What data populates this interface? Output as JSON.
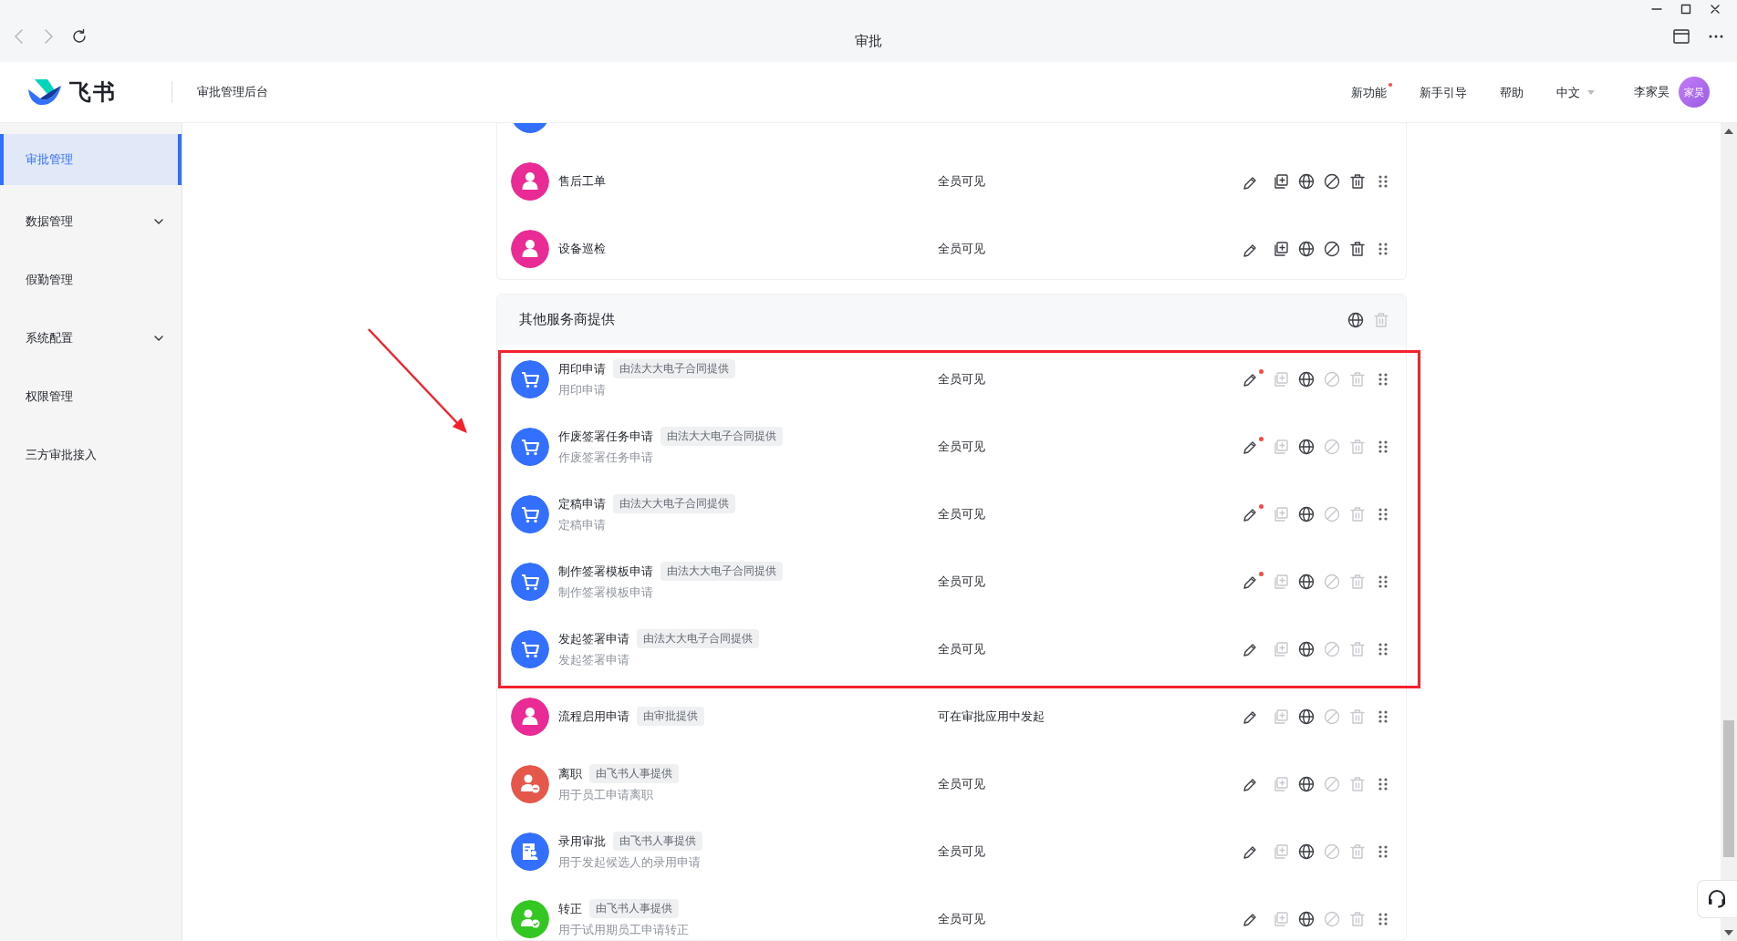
{
  "browser": {
    "title": "审批"
  },
  "header": {
    "brand": "飞书",
    "product": "审批管理后台",
    "nav": [
      {
        "label": "新功能",
        "dot": true,
        "dropdown": false
      },
      {
        "label": "新手引导",
        "dot": false,
        "dropdown": false
      },
      {
        "label": "帮助",
        "dot": false,
        "dropdown": false
      },
      {
        "label": "中文",
        "dot": false,
        "dropdown": true
      }
    ],
    "user": {
      "name": "李家昊",
      "avatar_text": "家昊"
    }
  },
  "sidebar": {
    "items": [
      {
        "label": "审批管理",
        "selected": true,
        "expandable": false
      },
      {
        "label": "数据管理",
        "selected": false,
        "expandable": true
      },
      {
        "label": "假勤管理",
        "selected": false,
        "expandable": false
      },
      {
        "label": "系统配置",
        "selected": false,
        "expandable": true
      },
      {
        "label": "权限管理",
        "selected": false,
        "expandable": false
      },
      {
        "label": "三方审批接入",
        "selected": false,
        "expandable": false
      }
    ]
  },
  "groups": [
    {
      "rows": [
        {
          "color": "#3370ff"
        },
        {
          "kind": "person",
          "color": "#ea2a95",
          "title": "售后工单",
          "visibility": "全员可见",
          "actions_enabled": true,
          "edit_dot": false
        },
        {
          "kind": "person",
          "color": "#ea2a95",
          "title": "设备巡检",
          "visibility": "全员可见",
          "actions_enabled": true,
          "edit_dot": false
        }
      ]
    },
    {
      "title": "其他服务商提供",
      "delete_enabled": false,
      "rows": [
        {
          "kind": "cart",
          "color": "#3370ff",
          "title": "用印申请",
          "tag": "由法大大电子合同提供",
          "subtitle": "用印申请",
          "visibility": "全员可见",
          "actions_enabled": false,
          "edit_dot": true
        },
        {
          "kind": "cart",
          "color": "#3370ff",
          "title": "作废签署任务申请",
          "tag": "由法大大电子合同提供",
          "subtitle": "作废签署任务申请",
          "visibility": "全员可见",
          "actions_enabled": false,
          "edit_dot": true
        },
        {
          "kind": "cart",
          "color": "#3370ff",
          "title": "定稿申请",
          "tag": "由法大大电子合同提供",
          "subtitle": "定稿申请",
          "visibility": "全员可见",
          "actions_enabled": false,
          "edit_dot": true
        },
        {
          "kind": "cart",
          "color": "#3370ff",
          "title": "制作签署模板申请",
          "tag": "由法大大电子合同提供",
          "subtitle": "制作签署模板申请",
          "visibility": "全员可见",
          "actions_enabled": false,
          "edit_dot": true
        },
        {
          "kind": "cart",
          "color": "#3370ff",
          "title": "发起签署申请",
          "tag": "由法大大电子合同提供",
          "subtitle": "发起签署申请",
          "visibility": "全员可见",
          "actions_enabled": false,
          "edit_dot": false
        },
        {
          "kind": "person",
          "color": "#ea2a95",
          "title": "流程启用申请",
          "tag": "由审批提供",
          "visibility": "可在审批应用中发起",
          "actions_enabled": false,
          "edit_dot": false
        },
        {
          "kind": "person-minus",
          "color": "#e5574b",
          "title": "离职",
          "tag": "由飞书人事提供",
          "subtitle": "用于员工申请离职",
          "visibility": "全员可见",
          "actions_enabled": false,
          "edit_dot": false
        },
        {
          "kind": "form-person",
          "color": "#3370ff",
          "title": "录用审批",
          "tag": "由飞书人事提供",
          "subtitle": "用于发起候选人的录用申请",
          "visibility": "全员可见",
          "actions_enabled": false,
          "edit_dot": false
        },
        {
          "kind": "person-check",
          "color": "#34c724",
          "title": "转正",
          "tag": "由飞书人事提供",
          "subtitle": "用于试用期员工申请转正",
          "visibility": "全员可见",
          "actions_enabled": false,
          "edit_dot": false
        }
      ]
    }
  ]
}
